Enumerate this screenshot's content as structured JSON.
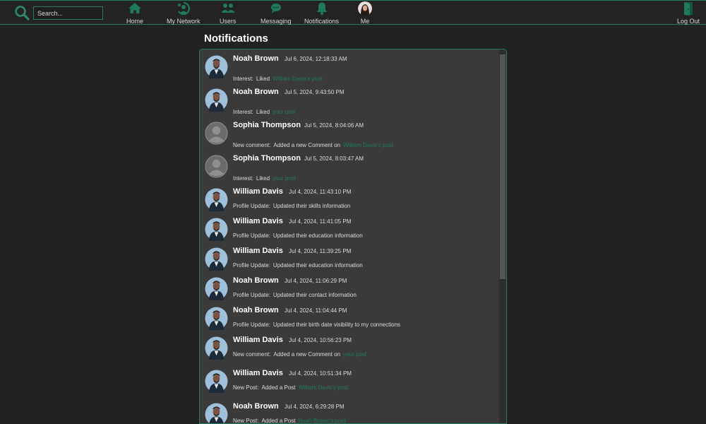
{
  "search": {
    "placeholder": "Search..."
  },
  "nav": [
    {
      "label": "Home",
      "icon": "home-icon"
    },
    {
      "label": "My Network",
      "icon": "network-icon"
    },
    {
      "label": "Users",
      "icon": "users-icon"
    },
    {
      "label": "Messaging",
      "icon": "chat-icon"
    },
    {
      "label": "Notifications",
      "icon": "bell-icon"
    },
    {
      "label": "Me",
      "icon": "avatar"
    }
  ],
  "logout": {
    "label": "Log Out",
    "icon": "door-icon"
  },
  "page": {
    "title": "Notifications"
  },
  "notifications": [
    {
      "name": "Noah Brown",
      "time": "Jul 6, 2024, 12:18:33 AM",
      "type": "Interest:",
      "action": "Liked",
      "link": "William Davis's post",
      "avatar": "photo"
    },
    {
      "name": "Noah Brown",
      "time": "Jul 5, 2024, 9:43:50 PM",
      "type": "Interest:",
      "action": "Liked",
      "link": "your post",
      "avatar": "photo"
    },
    {
      "name": "Sophia Thompson",
      "time": "Jul 5, 2024, 8:04:06 AM",
      "type": "New comment:",
      "action": "Added a new Comment on",
      "link": "William Davis's post",
      "avatar": "placeholder"
    },
    {
      "name": "Sophia Thompson",
      "time": "Jul 5, 2024, 8:03:47 AM",
      "type": "Interest:",
      "action": "Liked",
      "link": "your post",
      "avatar": "placeholder"
    },
    {
      "name": "William Davis",
      "time": "Jul 4, 2024, 11:43:10 PM",
      "type": "Profile Update:",
      "action": "Updated their skills information",
      "link": "",
      "avatar": "photo"
    },
    {
      "name": "William Davis",
      "time": "Jul 4, 2024, 11:41:05 PM",
      "type": "Profile Update:",
      "action": "Updated their education information",
      "link": "",
      "avatar": "photo"
    },
    {
      "name": "William Davis",
      "time": "Jul 4, 2024, 11:39:25 PM",
      "type": "Profile Update:",
      "action": "Updated their education information",
      "link": "",
      "avatar": "photo"
    },
    {
      "name": "Noah Brown",
      "time": "Jul 4, 2024, 11:06:29 PM",
      "type": "Profile Update:",
      "action": "Updated their contact information",
      "link": "",
      "avatar": "photo"
    },
    {
      "name": "Noah Brown",
      "time": "Jul 4, 2024, 11:04:44 PM",
      "type": "Profile Update:",
      "action": "Updated their birth date visibility to my connections",
      "link": "",
      "avatar": "photo"
    },
    {
      "name": "William Davis",
      "time": "Jul 4, 2024, 10:56:23 PM",
      "type": "New comment:",
      "action": "Added a new Comment on",
      "link": "your post",
      "avatar": "photo"
    },
    {
      "name": "William Davis",
      "time": "Jul 4, 2024, 10:51:34 PM",
      "type": "New Post:",
      "action": "Added a Post",
      "link": "William Davis's post",
      "avatar": "photo"
    },
    {
      "name": "Noah Brown",
      "time": "Jul 4, 2024, 6:29:28 PM",
      "type": "New Post:",
      "action": "Added a Post",
      "link": "Noah Brown's post",
      "avatar": "photo"
    }
  ],
  "colors": {
    "accent": "#2a7a62",
    "link": "#1f7a5a",
    "background": "#222222",
    "panel": "#3a3a3a"
  }
}
